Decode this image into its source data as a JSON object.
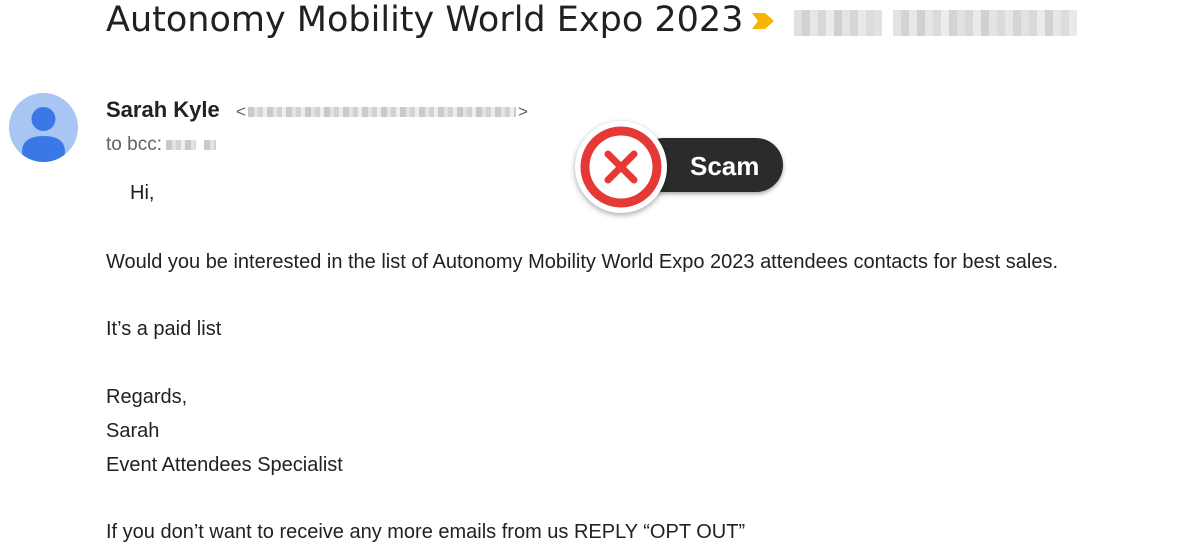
{
  "email": {
    "subject": "Autonomy Mobility World Expo 2023",
    "sender": {
      "name": "Sarah Kyle",
      "email_open": "<",
      "email_close": ">"
    },
    "recipient_label": "to bcc:",
    "body": {
      "greeting": "Hi,",
      "paragraph1": "Would you be interested in the list of  Autonomy Mobility World Expo 2023 attendees contacts for best sales.",
      "paragraph2": "It’s a paid list",
      "signoff": "Regards,",
      "sign_name": "Sarah",
      "sign_title": "Event Attendees Specialist",
      "footer": "If you don’t want to receive any more emails from us REPLY “OPT OUT”"
    }
  },
  "badge": {
    "label": "Scam",
    "icon": "x-mark-icon",
    "ring_color": "#e53935",
    "pill_color": "#2b2b2b"
  },
  "colors": {
    "important_marker": "#f4b400",
    "avatar_bg": "#a9c5f4",
    "avatar_fg": "#3b78e7"
  }
}
